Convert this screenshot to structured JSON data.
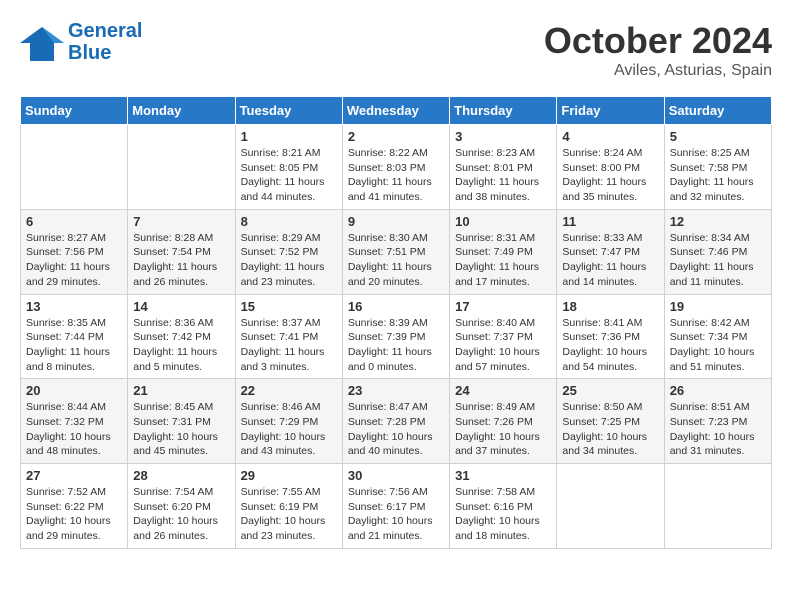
{
  "header": {
    "logo_line1": "General",
    "logo_line2": "Blue",
    "month_title": "October 2024",
    "location": "Aviles, Asturias, Spain"
  },
  "weekdays": [
    "Sunday",
    "Monday",
    "Tuesday",
    "Wednesday",
    "Thursday",
    "Friday",
    "Saturday"
  ],
  "weeks": [
    [
      {
        "day": "",
        "info": ""
      },
      {
        "day": "",
        "info": ""
      },
      {
        "day": "1",
        "info": "Sunrise: 8:21 AM\nSunset: 8:05 PM\nDaylight: 11 hours and 44 minutes."
      },
      {
        "day": "2",
        "info": "Sunrise: 8:22 AM\nSunset: 8:03 PM\nDaylight: 11 hours and 41 minutes."
      },
      {
        "day": "3",
        "info": "Sunrise: 8:23 AM\nSunset: 8:01 PM\nDaylight: 11 hours and 38 minutes."
      },
      {
        "day": "4",
        "info": "Sunrise: 8:24 AM\nSunset: 8:00 PM\nDaylight: 11 hours and 35 minutes."
      },
      {
        "day": "5",
        "info": "Sunrise: 8:25 AM\nSunset: 7:58 PM\nDaylight: 11 hours and 32 minutes."
      }
    ],
    [
      {
        "day": "6",
        "info": "Sunrise: 8:27 AM\nSunset: 7:56 PM\nDaylight: 11 hours and 29 minutes."
      },
      {
        "day": "7",
        "info": "Sunrise: 8:28 AM\nSunset: 7:54 PM\nDaylight: 11 hours and 26 minutes."
      },
      {
        "day": "8",
        "info": "Sunrise: 8:29 AM\nSunset: 7:52 PM\nDaylight: 11 hours and 23 minutes."
      },
      {
        "day": "9",
        "info": "Sunrise: 8:30 AM\nSunset: 7:51 PM\nDaylight: 11 hours and 20 minutes."
      },
      {
        "day": "10",
        "info": "Sunrise: 8:31 AM\nSunset: 7:49 PM\nDaylight: 11 hours and 17 minutes."
      },
      {
        "day": "11",
        "info": "Sunrise: 8:33 AM\nSunset: 7:47 PM\nDaylight: 11 hours and 14 minutes."
      },
      {
        "day": "12",
        "info": "Sunrise: 8:34 AM\nSunset: 7:46 PM\nDaylight: 11 hours and 11 minutes."
      }
    ],
    [
      {
        "day": "13",
        "info": "Sunrise: 8:35 AM\nSunset: 7:44 PM\nDaylight: 11 hours and 8 minutes."
      },
      {
        "day": "14",
        "info": "Sunrise: 8:36 AM\nSunset: 7:42 PM\nDaylight: 11 hours and 5 minutes."
      },
      {
        "day": "15",
        "info": "Sunrise: 8:37 AM\nSunset: 7:41 PM\nDaylight: 11 hours and 3 minutes."
      },
      {
        "day": "16",
        "info": "Sunrise: 8:39 AM\nSunset: 7:39 PM\nDaylight: 11 hours and 0 minutes."
      },
      {
        "day": "17",
        "info": "Sunrise: 8:40 AM\nSunset: 7:37 PM\nDaylight: 10 hours and 57 minutes."
      },
      {
        "day": "18",
        "info": "Sunrise: 8:41 AM\nSunset: 7:36 PM\nDaylight: 10 hours and 54 minutes."
      },
      {
        "day": "19",
        "info": "Sunrise: 8:42 AM\nSunset: 7:34 PM\nDaylight: 10 hours and 51 minutes."
      }
    ],
    [
      {
        "day": "20",
        "info": "Sunrise: 8:44 AM\nSunset: 7:32 PM\nDaylight: 10 hours and 48 minutes."
      },
      {
        "day": "21",
        "info": "Sunrise: 8:45 AM\nSunset: 7:31 PM\nDaylight: 10 hours and 45 minutes."
      },
      {
        "day": "22",
        "info": "Sunrise: 8:46 AM\nSunset: 7:29 PM\nDaylight: 10 hours and 43 minutes."
      },
      {
        "day": "23",
        "info": "Sunrise: 8:47 AM\nSunset: 7:28 PM\nDaylight: 10 hours and 40 minutes."
      },
      {
        "day": "24",
        "info": "Sunrise: 8:49 AM\nSunset: 7:26 PM\nDaylight: 10 hours and 37 minutes."
      },
      {
        "day": "25",
        "info": "Sunrise: 8:50 AM\nSunset: 7:25 PM\nDaylight: 10 hours and 34 minutes."
      },
      {
        "day": "26",
        "info": "Sunrise: 8:51 AM\nSunset: 7:23 PM\nDaylight: 10 hours and 31 minutes."
      }
    ],
    [
      {
        "day": "27",
        "info": "Sunrise: 7:52 AM\nSunset: 6:22 PM\nDaylight: 10 hours and 29 minutes."
      },
      {
        "day": "28",
        "info": "Sunrise: 7:54 AM\nSunset: 6:20 PM\nDaylight: 10 hours and 26 minutes."
      },
      {
        "day": "29",
        "info": "Sunrise: 7:55 AM\nSunset: 6:19 PM\nDaylight: 10 hours and 23 minutes."
      },
      {
        "day": "30",
        "info": "Sunrise: 7:56 AM\nSunset: 6:17 PM\nDaylight: 10 hours and 21 minutes."
      },
      {
        "day": "31",
        "info": "Sunrise: 7:58 AM\nSunset: 6:16 PM\nDaylight: 10 hours and 18 minutes."
      },
      {
        "day": "",
        "info": ""
      },
      {
        "day": "",
        "info": ""
      }
    ]
  ]
}
